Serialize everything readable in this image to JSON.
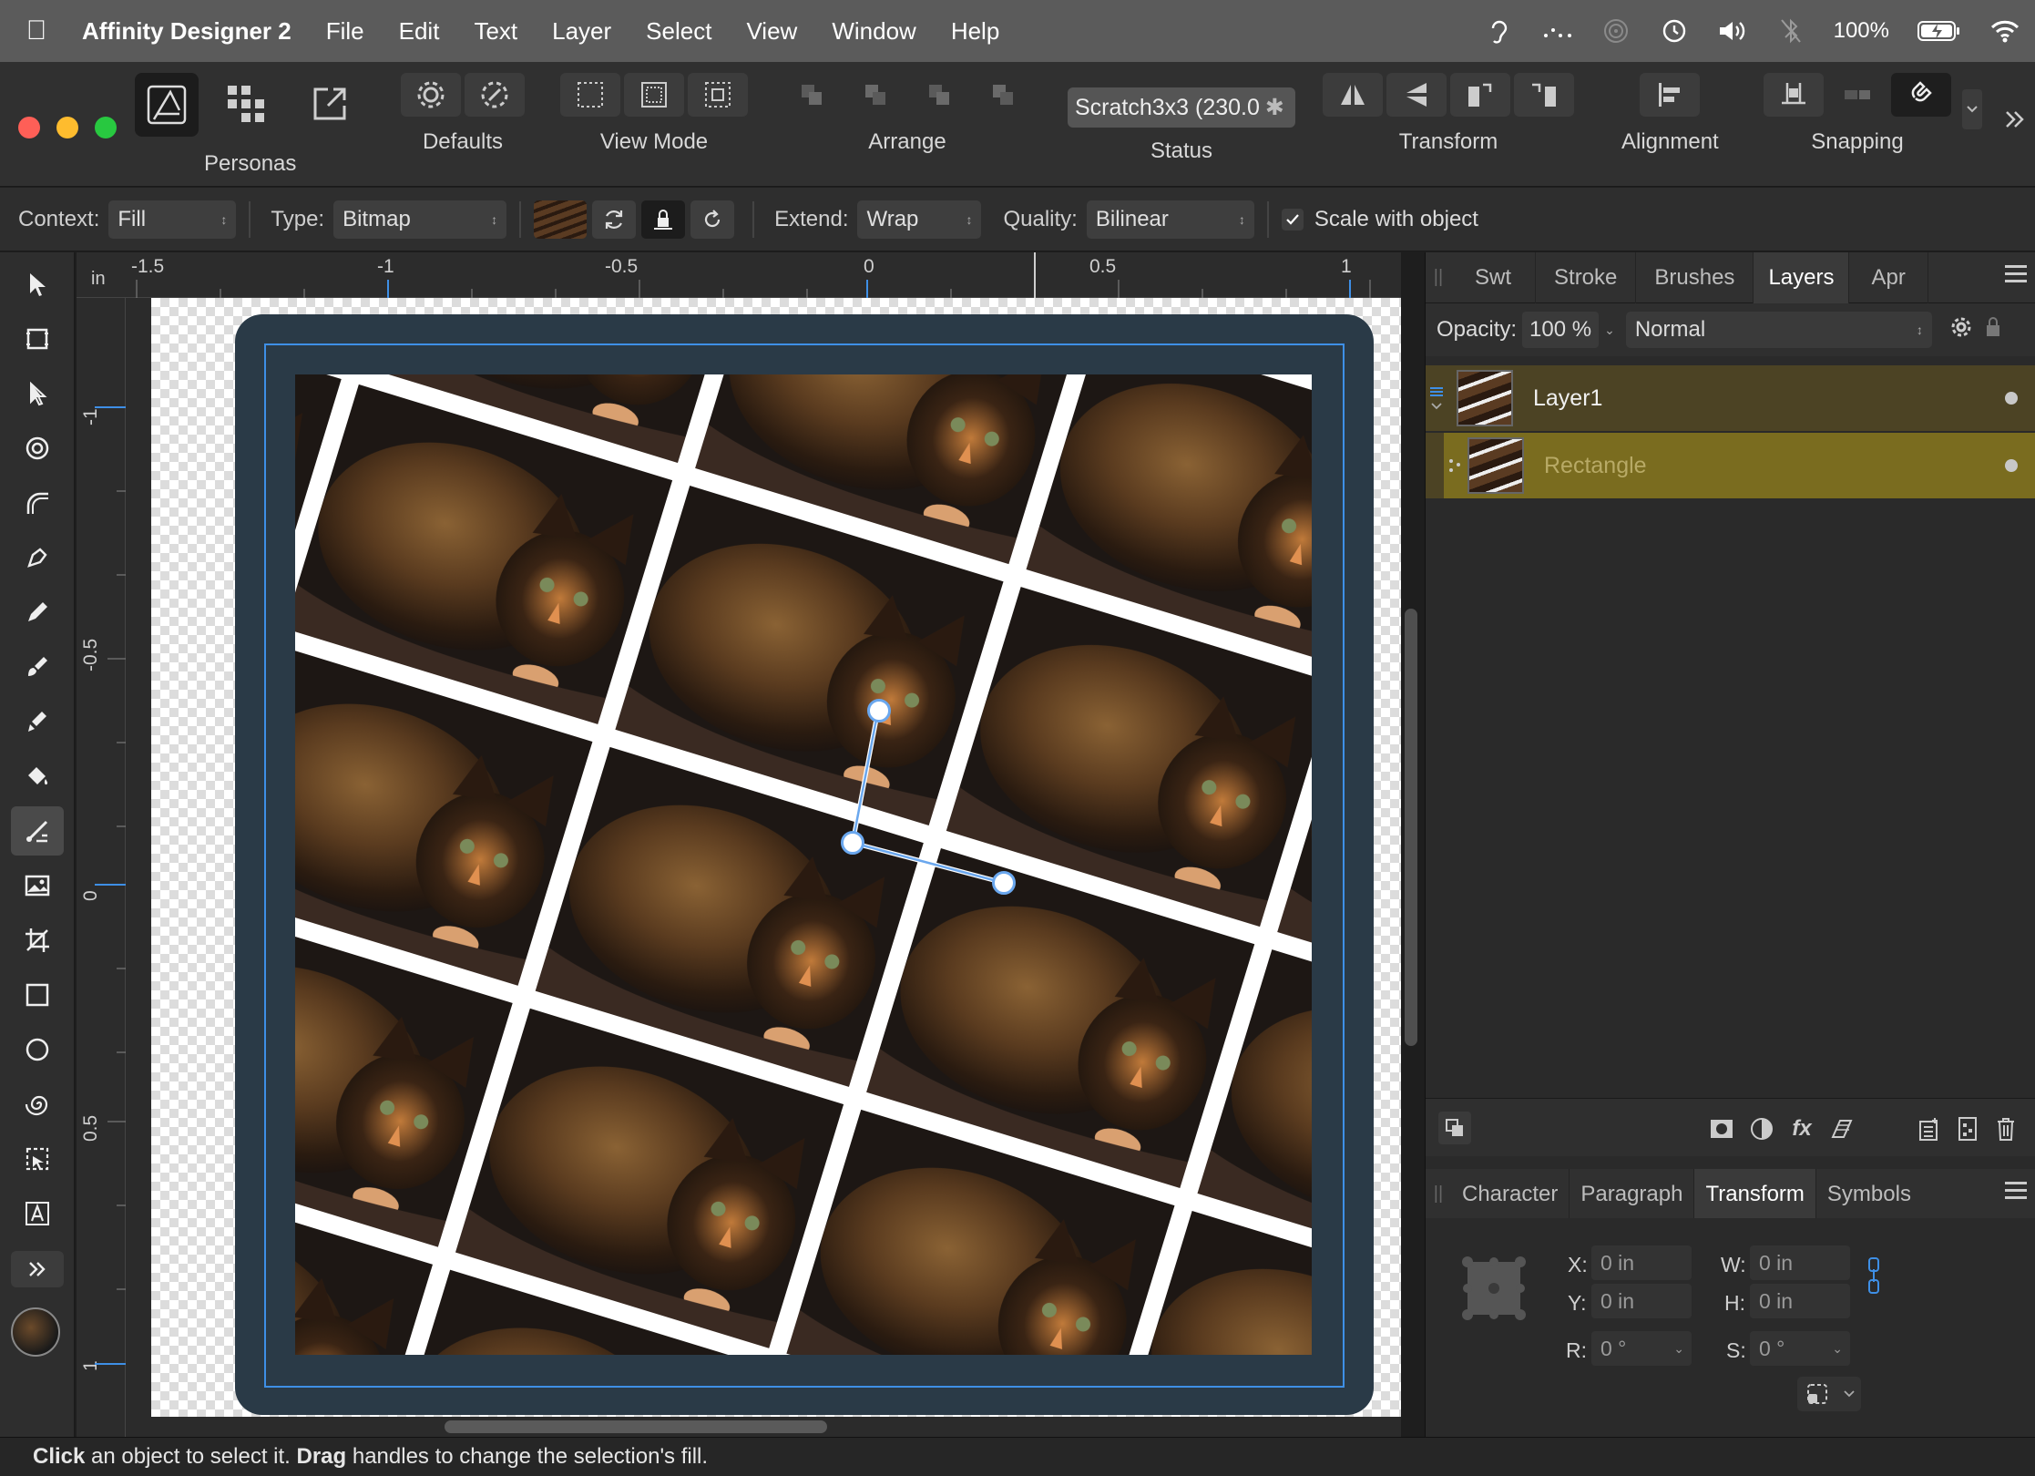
{
  "menubar": {
    "app_name": "Affinity Designer 2",
    "items": [
      "File",
      "Edit",
      "Text",
      "Layer",
      "Select",
      "View",
      "Window",
      "Help"
    ],
    "battery": "100%"
  },
  "toolbar": {
    "personas_label": "Personas",
    "defaults_label": "Defaults",
    "view_mode_label": "View Mode",
    "arrange_label": "Arrange",
    "status_label": "Status",
    "status_value": "Scratch3x3 (230.0",
    "transform_label": "Transform",
    "alignment_label": "Alignment",
    "snapping_label": "Snapping"
  },
  "context": {
    "context_label": "Context:",
    "context_value": "Fill",
    "type_label": "Type:",
    "type_value": "Bitmap",
    "extend_label": "Extend:",
    "extend_value": "Wrap",
    "quality_label": "Quality:",
    "quality_value": "Bilinear",
    "scale_label": "Scale with object",
    "scale_checked": true
  },
  "rulers": {
    "unit": "in",
    "top_ticks": [
      "-1.5",
      "-1",
      "-0.5",
      "0",
      "0.5",
      "1"
    ],
    "left_ticks": [
      "-1",
      "-0.5",
      "0",
      "0.5",
      "1"
    ]
  },
  "layers_panel": {
    "tabs": [
      "Swt",
      "Stroke",
      "Brushes",
      "Layers",
      "Apr"
    ],
    "active_tab": "Layers",
    "opacity_label": "Opacity:",
    "opacity_value": "100 %",
    "blend_mode": "Normal",
    "layers": [
      {
        "name": "Layer1",
        "selected": false
      },
      {
        "name": "Rectangle",
        "selected": true
      }
    ]
  },
  "transform_panel": {
    "tabs": [
      "Character",
      "Paragraph",
      "Transform",
      "Symbols"
    ],
    "active_tab": "Transform",
    "x_label": "X:",
    "x_value": "0 in",
    "y_label": "Y:",
    "y_value": "0 in",
    "w_label": "W:",
    "w_value": "0 in",
    "h_label": "H:",
    "h_value": "0 in",
    "r_label": "R:",
    "r_value": "0 °",
    "s_label": "S:",
    "s_value": "0 °"
  },
  "statusbar": {
    "click_word": "Click",
    "click_text": " an object to select it. ",
    "drag_word": "Drag",
    "drag_text": " handles to change the selection's fill."
  },
  "colors": {
    "accent": "#3e8fe6",
    "layer1_bg": "#4c4324",
    "rectangle_bg": "#7a6c1f",
    "frame": "#2a3a47"
  }
}
